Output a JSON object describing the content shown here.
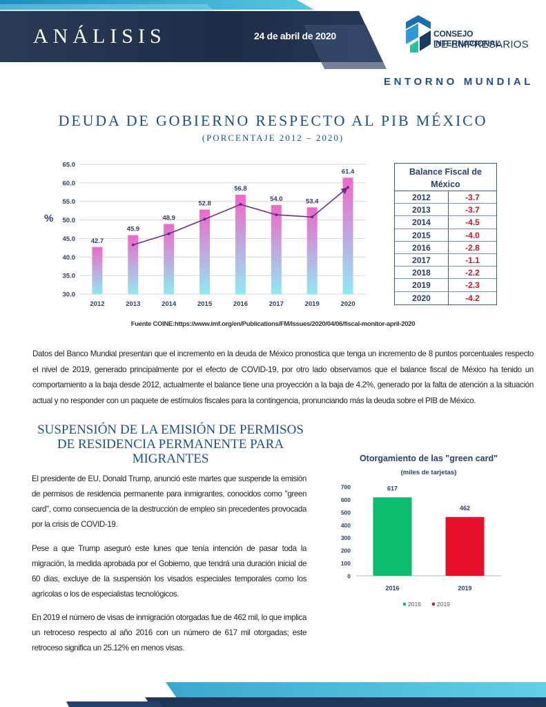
{
  "header": {
    "title": "ANÁLISIS",
    "date": "24 de abril de 2020",
    "org_line1": "CONSEJO INTERNACIONAL",
    "org_line2": "DE EMPRESARIOS",
    "section": "ENTORNO MUNDIAL"
  },
  "colors": {
    "navy": "#1b2a44",
    "blue_title": "#1d4f8b",
    "cyan_accent": "#3fb6d4",
    "negative_red": "#d0142a",
    "bar_pink": "#f068c8",
    "bar_cyan": "#8fe9f4",
    "bar_green": "#0bbd6e",
    "bar_red": "#e8102a",
    "trend_purple": "#6a2c8c"
  },
  "section1": {
    "title": "DEUDA DE GOBIERNO RESPECTO AL PIB MÉXICO",
    "subtitle": "(PORCENTAJE 2012 – 2020)",
    "y_unit": "%",
    "source": "Fuente COINE:https://www.imf.org/en/Publications/FM/Issues/2020/04/06/fiscal-monitor-april-2020",
    "paragraph": "Datos del Banco Mundial  presentan que el incremento en la deuda de México pronostica  que tenga un incremento de 8 puntos porcentuales respecto el nivel de 2019, generado principalmente por el efecto de COVID-19, por otro lado observamos que el balance fiscal de México ha tenido un comportamiento a la baja desde 2012, actualmente el balance tiene una proyección a la baja de 4.2%, generado por la falta de atención a la situación actual y no responder con un paquete de estímulos fiscales para la contingencia, pronunciando más la deuda sobre el PIB de México."
  },
  "balance_table": {
    "title_line1": "Balance Fiscal de",
    "title_line2": "México",
    "rows": [
      {
        "year": "2012",
        "value": "-3.7"
      },
      {
        "year": "2013",
        "value": "-3.7"
      },
      {
        "year": "2014",
        "value": "-4.5"
      },
      {
        "year": "2015",
        "value": "-4.0"
      },
      {
        "year": "2016",
        "value": "-2.8"
      },
      {
        "year": "2017",
        "value": "-1.1"
      },
      {
        "year": "2018",
        "value": "-2.2"
      },
      {
        "year": "2019",
        "value": "-2.3"
      },
      {
        "year": "2020",
        "value": "-4.2"
      }
    ]
  },
  "section2": {
    "title": "SUSPENSIÓN DE  LA EMISIÓN DE PERMISOS DE RESIDENCIA PERMANENTE PARA MIGRANTES",
    "p1": "El presidente de EU, Donald Trump, anunció este martes que suspende la emisión de permisos de residencia permanente para inmigrantes, conocidos como \"green card\", como consecuencia de la destrucción de empleo sin precedentes provocada por la crisis de COVID-19.",
    "p2": "Pese a que Trump aseguró este lunes que tenía intención de pasar toda la migración, la medida aprobada por el Gobierno, que tendrá una duración inicial de 60 días, excluye de la suspensión los visados especiales temporales como los agrícolas o los de especialistas tecnológicos.",
    "p3": "En 2019 el número de visas de inmigración otorgadas fue de 462 mil, lo que implica un retroceso respecto al año 2016 con un número de 617 mil otorgadas; este retroceso significa un 25.12% en menos visas."
  },
  "chart_data": [
    {
      "type": "bar",
      "categories": [
        "2012",
        "2013",
        "2014",
        "2015",
        "2016",
        "2017",
        "2019",
        "2020"
      ],
      "values": [
        42.7,
        45.9,
        48.9,
        52.8,
        56.8,
        54.0,
        53.4,
        61.4
      ],
      "labels": [
        "42.7",
        "45.9",
        "48.9",
        "52.8",
        "56.8",
        "54.0",
        "53.4",
        "61.4"
      ],
      "ylim": [
        30.0,
        65.0
      ],
      "yticks": [
        "30.0",
        "35.0",
        "40.0",
        "45.0",
        "50.0",
        "55.0",
        "60.0",
        "65.0"
      ],
      "ylabel": "%",
      "title": "",
      "trendline": true,
      "grid": true
    },
    {
      "type": "bar",
      "title": "Otorgamiento de las \"green card\"",
      "subtitle": "(miles de tarjetas)",
      "categories": [
        "2016",
        "2019"
      ],
      "values": [
        617,
        462
      ],
      "labels": [
        "617",
        "462"
      ],
      "ylim": [
        0,
        700
      ],
      "yticks": [
        "0",
        "100",
        "200",
        "300",
        "400",
        "500",
        "600",
        "700"
      ],
      "legend": [
        "2016",
        "2019"
      ],
      "legend_position": "bottom"
    }
  ]
}
